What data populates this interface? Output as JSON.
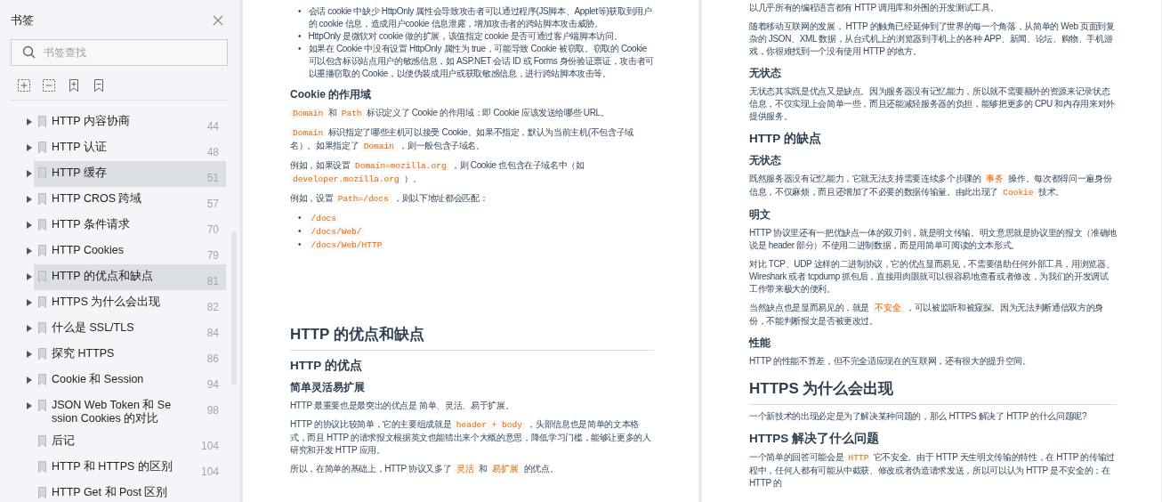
{
  "sidebar": {
    "title": "书签",
    "search": {
      "placeholder": "书签查找"
    },
    "items": [
      {
        "label": "HTTP 内容协商",
        "page": "44",
        "expandable": true,
        "selected": false
      },
      {
        "label": "HTTP 认证",
        "page": "48",
        "expandable": true,
        "selected": false
      },
      {
        "label": "HTTP 缓存",
        "page": "51",
        "expandable": true,
        "selected": true
      },
      {
        "label": "HTTP CROS 跨域",
        "page": "57",
        "expandable": true,
        "selected": false
      },
      {
        "label": "HTTP 条件请求",
        "page": "70",
        "expandable": true,
        "selected": false
      },
      {
        "label": "HTTP Cookies",
        "page": "79",
        "expandable": true,
        "selected": false
      },
      {
        "label": "HTTP 的优点和缺点",
        "page": "81",
        "expandable": true,
        "selected": true
      },
      {
        "label": "HTTPS 为什么会出现",
        "page": "82",
        "expandable": true,
        "selected": false
      },
      {
        "label": "什么是 SSL/TLS",
        "page": "84",
        "expandable": true,
        "selected": false
      },
      {
        "label": "探究 HTTPS",
        "page": "86",
        "expandable": true,
        "selected": false
      },
      {
        "label": "Cookie 和 Session",
        "page": "94",
        "expandable": true,
        "selected": false
      },
      {
        "label": "JSON Web Token 和 Session Cookies 的对比",
        "page": "98",
        "expandable": true,
        "selected": false
      },
      {
        "label": "后记",
        "page": "104",
        "expandable": false,
        "selected": false
      },
      {
        "label": "HTTP 和 HTTPS 的区别",
        "page": "104",
        "expandable": false,
        "selected": false
      },
      {
        "label": "HTTP Get 和 Post 区别",
        "expandable": false,
        "selected": false
      }
    ]
  },
  "left_page": {
    "sections": [
      {
        "blocks": [
          {
            "kind": "bullets",
            "marker": "•",
            "items": [
              [
                {
                  "text": "会话 cookie 中缺少 HttpOnly 属性会导致攻击者可以通过程序(JS脚本、Applet等)获取到用户的 cookie 信息，造成用户cookie 信息泄露，增加攻击者的跨站脚本攻击威胁。",
                  "kind": "plain"
                }
              ],
              [
                {
                  "text": "HttpOnly 是微软对 cookie 做的扩展，该值指定 cookie 是否可通过客户端脚本访问。",
                  "kind": "plain"
                }
              ],
              [
                {
                  "text": "如果在 Cookie 中没有设置 HttpOnly 属性为 true，可能导致 Cookie 被窃取。窃取的 Cookie 可以包含标识站点用户的敏感信息，如 ASP.NET 会话 ID 或 Forms 身份验证票证，攻击者可以重播窃取的 Cookie，以便伪装成用户或获取敏感信息，进行跨站脚本攻击等。",
                  "kind": "plain"
                }
              ]
            ]
          },
          {
            "kind": "h3",
            "text": "Cookie 的作用域"
          },
          {
            "kind": "p",
            "parts": [
              {
                "text": "Domain",
                "kind": "code"
              },
              {
                "text": " 和 ",
                "kind": "plain"
              },
              {
                "text": "Path",
                "kind": "code"
              },
              {
                "text": " 标识定义了 Cookie 的作用域：即 Cookie 应该发送给哪些 URL。",
                "kind": "plain"
              }
            ]
          },
          {
            "kind": "p",
            "parts": [
              {
                "text": "Domain",
                "kind": "code"
              },
              {
                "text": " 标识指定了哪些主机可以接受 Cookie。如果不指定，默认为当前主机(不包含子域名）。如果指定了 ",
                "kind": "plain"
              },
              {
                "text": "Domain",
                "kind": "code"
              },
              {
                "text": " ，则一般包含子域名。",
                "kind": "plain"
              }
            ]
          },
          {
            "kind": "p",
            "parts": [
              {
                "text": "例如，如果设置 ",
                "kind": "plain"
              },
              {
                "text": "Domain=mozilla.org",
                "kind": "code"
              },
              {
                "text": " ，则 Cookie 也包含在子域名中（如 ",
                "kind": "plain"
              },
              {
                "text": "developer.mozilla.org",
                "kind": "code"
              },
              {
                "text": " ）。",
                "kind": "plain"
              }
            ]
          },
          {
            "kind": "p",
            "parts": [
              {
                "text": "例如，设置 ",
                "kind": "plain"
              },
              {
                "text": "Path=/docs",
                "kind": "code"
              },
              {
                "text": " ，则以下地址都会匹配：",
                "kind": "plain"
              }
            ]
          },
          {
            "kind": "bullets",
            "marker": "•",
            "items": [
              [
                {
                  "text": "/docs",
                  "kind": "code"
                }
              ],
              [
                {
                  "text": "/docs/Web/",
                  "kind": "code"
                }
              ],
              [
                {
                  "text": "/docs/Web/HTTP",
                  "kind": "code"
                }
              ]
            ]
          }
        ]
      },
      {
        "blocks": [
          {
            "kind": "h1",
            "text": "HTTP 的优点和缺点"
          },
          {
            "kind": "h2",
            "text": "HTTP 的优点"
          },
          {
            "kind": "h3",
            "text": "简单灵活易扩展"
          },
          {
            "kind": "p",
            "parts": [
              {
                "text": "HTTP 最重要也是最突出的优点是 简单、灵活、易于扩展。",
                "kind": "plain"
              }
            ]
          },
          {
            "kind": "p",
            "parts": [
              {
                "text": "HTTP 的协议比较简单，它的主要组成就是 ",
                "kind": "plain"
              },
              {
                "text": "header + body",
                "kind": "code"
              },
              {
                "text": " ，头部信息也是简单的文本格式，而且 HTTP 的请求报文根据英文也能猜出来个大概的意思，降低学习门槛，能够让更多的人研究和开发 HTTP 应用。",
                "kind": "plain"
              }
            ]
          },
          {
            "kind": "p",
            "parts": [
              {
                "text": "所以，在简单的基础上，HTTP 协议又多了 ",
                "kind": "plain"
              },
              {
                "text": "灵活",
                "kind": "code"
              },
              {
                "text": " 和 ",
                "kind": "plain"
              },
              {
                "text": "易扩展",
                "kind": "code"
              },
              {
                "text": " 的优点。",
                "kind": "plain"
              }
            ]
          }
        ]
      }
    ]
  },
  "right_page": {
    "sections": [
      {
        "blocks": [
          {
            "kind": "p",
            "parts": [
              {
                "text": "以几乎所有的编程语言都有 HTTP 调用库和外围的开发测试工具。",
                "kind": "plain"
              }
            ]
          },
          {
            "kind": "p",
            "parts": [
              {
                "text": "随着移动互联网的发展， HTTP 的触角已经延伸到了世界的每一个角落，从简单的 Web 页面到复杂的 JSON、XML 数据，从台式机上的浏览器到手机上的各种 APP、新闻、论坛、购物、手机游戏，你很难找到一个没有使用 HTTP 的地方。",
                "kind": "plain"
              }
            ]
          },
          {
            "kind": "h3",
            "text": "无状态"
          },
          {
            "kind": "p",
            "parts": [
              {
                "text": "无状态其实既是优点又是缺点。因为服务器没有记忆能力，所以就不需要额外的资源来记录状态信息，不仅实现上会简单一些，而且还能减轻服务器的负担，能够把更多的 CPU 和内存用来对外提供服务。",
                "kind": "plain"
              }
            ]
          },
          {
            "kind": "h2",
            "text": "HTTP 的缺点"
          },
          {
            "kind": "h3",
            "text": "无状态"
          },
          {
            "kind": "p",
            "parts": [
              {
                "text": "既然服务器没有记忆能力，它就无法支持需要连续多个步骤的 ",
                "kind": "plain"
              },
              {
                "text": "事务",
                "kind": "code"
              },
              {
                "text": " 操作。每次都得问一遍身份信息，不仅麻烦，而且还增加了不必要的数据传输量。由此出现了 ",
                "kind": "plain"
              },
              {
                "text": "Cookie",
                "kind": "code"
              },
              {
                "text": " 技术。",
                "kind": "plain"
              }
            ]
          },
          {
            "kind": "h3",
            "text": "明文"
          },
          {
            "kind": "p",
            "parts": [
              {
                "text": "HTTP 协议里还有一把优缺点一体的双刃剑，就是明文传输。明文意思就是协议里的报文（准确地说是 header 部分）不使用二进制数据，而是用简单可阅读的文本形式。",
                "kind": "plain"
              }
            ]
          },
          {
            "kind": "p",
            "parts": [
              {
                "text": "对比 TCP、UDP 这样的二进制协议，它的优点显而易见，不需要借助任何外部工具，用浏览器、Wireshark 或者 tcpdump 抓包后，直接用肉眼就可以很容易地查看或者修改，为我们的开发调试工作带来极大的便利。",
                "kind": "plain"
              }
            ]
          },
          {
            "kind": "p",
            "parts": [
              {
                "text": "当然缺点也是显而易见的，就是 ",
                "kind": "plain"
              },
              {
                "text": "不安全",
                "kind": "code"
              },
              {
                "text": " ，可以被监听和被窥探。因为无法判断通信双方的身份，不能判断报文是否被更改过。",
                "kind": "plain"
              }
            ]
          },
          {
            "kind": "h3",
            "text": "性能"
          },
          {
            "kind": "p",
            "parts": [
              {
                "text": "HTTP 的性能不算差，但不完全适应现在的互联网，还有很大的提升空间。",
                "kind": "plain"
              }
            ]
          },
          {
            "kind": "h1",
            "text": "HTTPS 为什么会出现"
          },
          {
            "kind": "p",
            "parts": [
              {
                "text": "一个新技术的出现必定是为了解决某种问题的，那么 HTTPS 解决了 HTTP 的什么问题呢?",
                "kind": "plain"
              }
            ]
          },
          {
            "kind": "h2",
            "text": "HTTPS 解决了什么问题"
          },
          {
            "kind": "p",
            "parts": [
              {
                "text": "一个简单的回答可能会是 ",
                "kind": "plain"
              },
              {
                "text": "HTTP",
                "kind": "code"
              },
              {
                "text": " 它不安全。由于 HTTP 天生明文传输的特性，在 HTTP 的传输过程中，任何人都有可能从中截获、修改或者伪造请求发送，所以可以认为 HTTP 是不安全的；在 HTTP 的",
                "kind": "plain"
              }
            ]
          }
        ]
      }
    ]
  }
}
